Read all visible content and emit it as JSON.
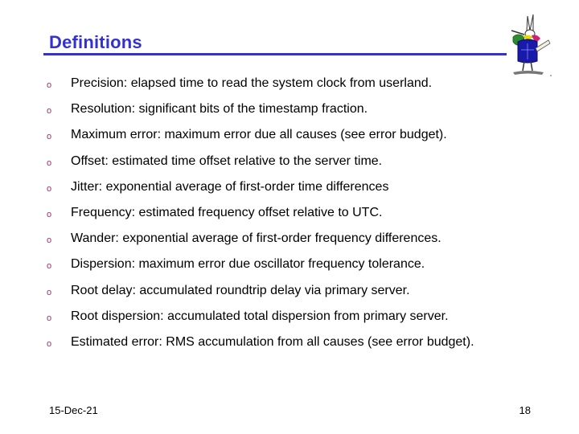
{
  "slide": {
    "title": "Definitions",
    "accent_color": "#3333cc",
    "bullet_color": "#993366",
    "bullet_glyph": "o",
    "logo_icon": "white-rabbit-icon",
    "bullets": [
      {
        "text": "Precision: elapsed time to read the system clock from userland."
      },
      {
        "text": "Resolution: significant bits of the timestamp fraction."
      },
      {
        "text": "Maximum error: maximum error due all causes (see error budget)."
      },
      {
        "text": "Offset: estimated time offset relative to the server time."
      },
      {
        "text": "Jitter: exponential average of first-order time differences"
      },
      {
        "text": "Frequency: estimated frequency offset relative to UTC."
      },
      {
        "text": "Wander: exponential average of first-order frequency differences."
      },
      {
        "text": "Dispersion: maximum error due oscillator frequency tolerance."
      },
      {
        "text": "Root delay: accumulated roundtrip delay via primary server."
      },
      {
        "text": "Root dispersion: accumulated total dispersion from primary server."
      },
      {
        "text": "Estimated error: RMS accumulation from all causes (see error budget)."
      }
    ]
  },
  "footer": {
    "date": "15-Dec-21",
    "page_number": "18"
  }
}
